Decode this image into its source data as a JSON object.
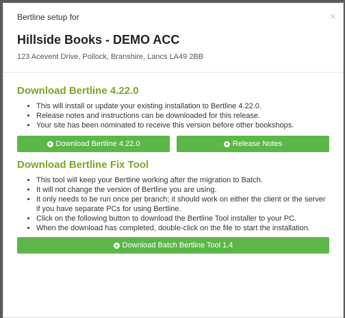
{
  "header": {
    "setup_label": "Bertline setup for",
    "close_glyph": "×",
    "shop_name": "Hillside Books - DEMO ACC",
    "address": "123 Acevent Drive, Pollock, Branshire, Lancs  LA49 2BB"
  },
  "download_section": {
    "title": "Download Bertline 4.22.0",
    "bullets": [
      "This will install or update your existing installation to Bertline 4.22.0.",
      "Release notes and instructions can be downloaded for this release.",
      "Your site has been nominated to receive this version before other bookshops."
    ],
    "download_button": "Download Bertline 4.22.0",
    "release_notes_button": "Release Notes"
  },
  "fix_section": {
    "title": "Download Bertline Fix Tool",
    "bullets": [
      "This tool will keep your Bertline working after the migration to Batch.",
      "It will not change the version of Bertline you are using.",
      "It only needs to be run once per branch; it should work on either the client or the server if you have separate PCs for using Bertline.",
      "Click on the following button to download the Bertline Tool installer to your PC.",
      "When the download has completed, double-click on the file to start the installation."
    ],
    "download_button": "Download Batch Bertline Tool 1.4"
  },
  "colors": {
    "accent_green": "#7aa623",
    "button_green": "#5cb749"
  },
  "icons": {
    "download": "download-circle-icon",
    "close": "close-icon"
  }
}
